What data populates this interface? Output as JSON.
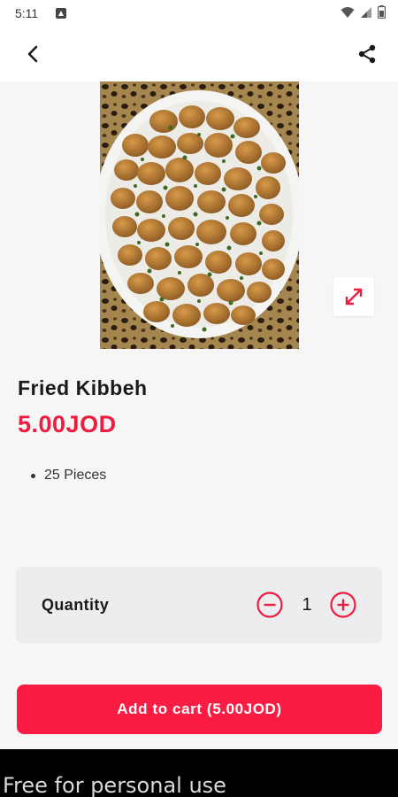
{
  "status_bar": {
    "time": "5:11",
    "icons": [
      "app-notification-icon",
      "wifi-icon",
      "signal-icon",
      "battery-icon"
    ]
  },
  "app_bar": {
    "back_icon": "chevron-left-icon",
    "share_icon": "share-icon"
  },
  "product": {
    "image_subject": "fried-kibbeh-plate",
    "expand_icon": "expand-arrows-icon",
    "name": "Fried Kibbeh",
    "price": "5.00JOD",
    "description": [
      "25 Pieces"
    ]
  },
  "quantity": {
    "label": "Quantity",
    "value": "1",
    "minus_icon": "minus-circle-icon",
    "plus_icon": "plus-circle-icon"
  },
  "add_to_cart": {
    "label": "Add to cart (5.00JOD)"
  },
  "footer": {
    "text": "Free for personal use"
  },
  "colors": {
    "accent": "#fb1c44",
    "price": "#ee1c3f",
    "background": "#f6f6f7",
    "card": "#ededf0"
  }
}
